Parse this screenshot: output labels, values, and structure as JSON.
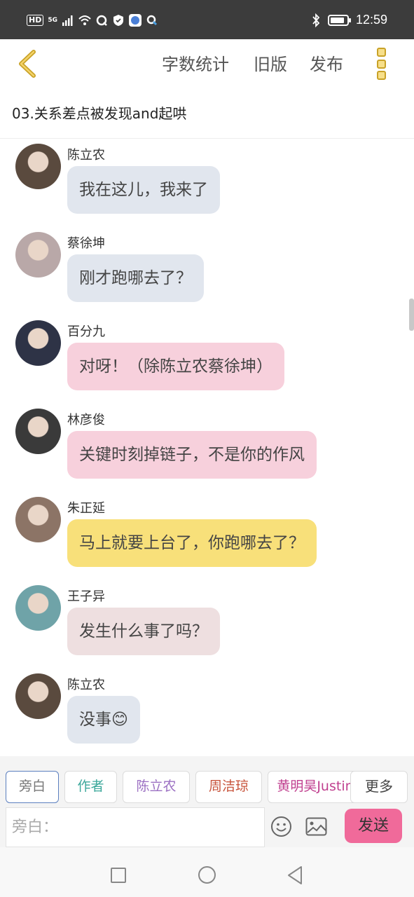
{
  "status_bar": {
    "hd": "HD",
    "network": "5G",
    "time": "12:59",
    "battery_level": 0.85,
    "icons": [
      "signal-icon",
      "wifi-icon",
      "q-app-icon",
      "shield-icon",
      "globe-app-icon",
      "search-app-icon",
      "bluetooth-icon",
      "battery-icon"
    ]
  },
  "toolbar": {
    "back_icon": "chevron-left-icon",
    "word_count_label": "字数统计",
    "old_version_label": "旧版",
    "publish_label": "发布",
    "more_icon": "more-vertical-icon",
    "accent_color": "#c9a227"
  },
  "chapter_title": "03.关系差点被发现and起哄",
  "messages": [
    {
      "sender": "陈立农",
      "text": "我在这儿，我来了",
      "bubble_color": "#e1e6ee",
      "avatar_color": "#5a4a3e"
    },
    {
      "sender": "蔡徐坤",
      "text": "刚才跑哪去了？",
      "bubble_color": "#e1e6ee",
      "avatar_color": "#b9a8a8"
    },
    {
      "sender": "百分九",
      "text": "对呀！（除陈立农蔡徐坤）",
      "bubble_color": "#f7d0dc",
      "avatar_color": "#2e3346"
    },
    {
      "sender": "林彦俊",
      "text": "关键时刻掉链子，不是你的作风",
      "bubble_color": "#f7d0dc",
      "avatar_color": "#3a3a3a"
    },
    {
      "sender": "朱正延",
      "text": "马上就要上台了，你跑哪去了？",
      "bubble_color": "#f8e07a",
      "avatar_color": "#8c7466"
    },
    {
      "sender": "王子异",
      "text": "发生什么事了吗？",
      "bubble_color": "#eedfe0",
      "avatar_color": "#6fa3a8"
    },
    {
      "sender": "陈立农",
      "text": "没事😊",
      "bubble_color": "#e1e6ee",
      "avatar_color": "#5a4a3e"
    }
  ],
  "role_selector": {
    "roles": [
      {
        "label": "旁白",
        "color": "#777777",
        "selected": true
      },
      {
        "label": "作者",
        "color": "#3aa79a",
        "selected": false
      },
      {
        "label": "陈立农",
        "color": "#9b6fc2",
        "selected": false
      },
      {
        "label": "周洁琼",
        "color": "#c8553d",
        "selected": false
      },
      {
        "label": "黄明昊Justin",
        "color": "#c0408f",
        "selected": false
      }
    ],
    "more_label": "更多"
  },
  "composer": {
    "placeholder": "旁白：",
    "emoji_icon": "smiley-icon",
    "image_icon": "image-icon",
    "send_label": "发送",
    "send_color": "#f06a9a"
  },
  "nav_bar": {
    "icons": [
      "recent-apps-square-icon",
      "home-circle-icon",
      "back-triangle-icon"
    ]
  }
}
